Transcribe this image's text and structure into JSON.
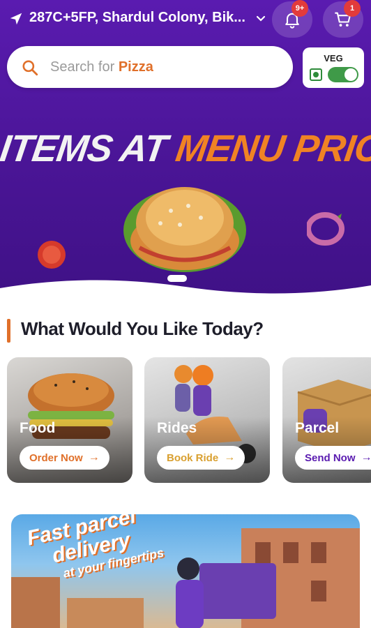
{
  "topbar": {
    "location": "287C+5FP, Shardul Colony, Bik...",
    "notifications_badge": "9+",
    "cart_badge": "1"
  },
  "search": {
    "placeholder_prefix": "Search for ",
    "placeholder_keyword": "Pizza"
  },
  "veg_toggle": {
    "label": "VEG",
    "on": true
  },
  "banner": {
    "title_part1": "ITEMS AT ",
    "title_part2": "MENU PRICES"
  },
  "section": {
    "title": "What Would You Like Today?"
  },
  "services": [
    {
      "label": "Food",
      "button": "Order Now"
    },
    {
      "label": "Rides",
      "button": "Book Ride"
    },
    {
      "label": "Parcel",
      "button": "Send Now"
    }
  ],
  "promo": {
    "line1": "Fast parcel",
    "line2": "delivery",
    "line3": "at your fingertips"
  },
  "colors": {
    "brand_purple": "#5a1bb0",
    "accent_orange": "#e0702a",
    "badge_red": "#e23b3b",
    "veg_green": "#3f9a48"
  },
  "icons": {
    "location": "navigation-arrow-icon",
    "dropdown": "chevron-down-icon",
    "notifications": "bell-icon",
    "cart": "cart-icon",
    "search": "search-icon"
  }
}
